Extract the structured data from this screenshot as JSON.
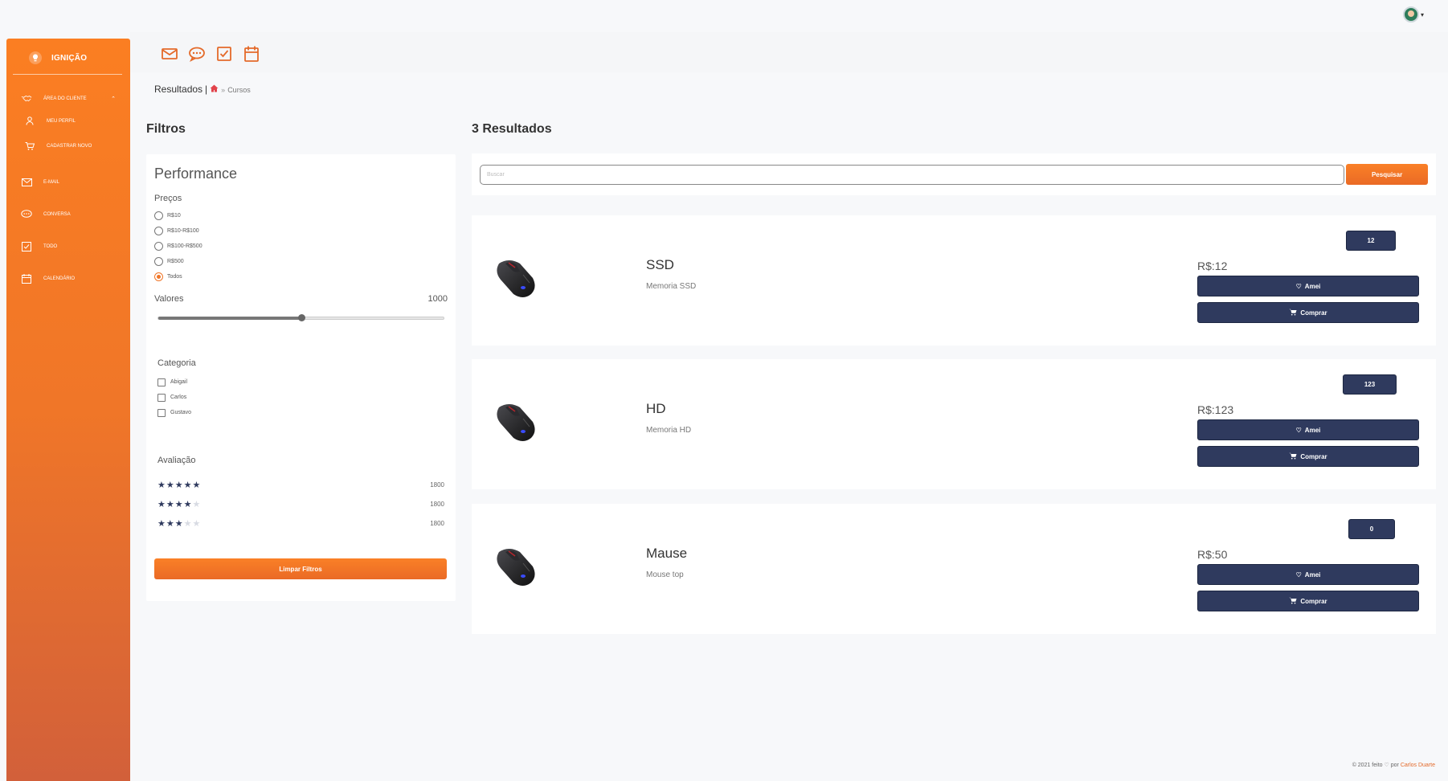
{
  "sidebar": {
    "brand": "IGNIÇÃO",
    "items": [
      {
        "label": "ÁREA DO CLIENTE",
        "icon": "handshake-icon"
      },
      {
        "label": "MEU PERFIL",
        "icon": "user-icon"
      },
      {
        "label": "CADASTRAR NOVO",
        "icon": "cart-icon"
      },
      {
        "label": "E-MAIL",
        "icon": "envelope-icon"
      },
      {
        "label": "CONVERSA",
        "icon": "chat-icon"
      },
      {
        "label": "TODO",
        "icon": "checkbox-icon"
      },
      {
        "label": "CALENDÁRIO",
        "icon": "calendar-icon"
      }
    ]
  },
  "breadcrumb": {
    "current": "Resultados",
    "separator": "|",
    "path": "Cursos"
  },
  "filters": {
    "section_title": "Filtros",
    "card_title": "Performance",
    "price_title": "Preços",
    "price_options": [
      "R$10",
      "R$10-R$100",
      "R$100-R$500",
      "R$500",
      "Todos"
    ],
    "price_selected": "Todos",
    "values_label": "Valores",
    "values_max": "1000",
    "slider_fraction": 0.5,
    "category_title": "Categoria",
    "categories": [
      "Abigail",
      "Carlos",
      "Gustavo"
    ],
    "rating_title": "Avaliação",
    "ratings": [
      {
        "stars": 5,
        "count": "1800"
      },
      {
        "stars": 4,
        "count": "1800"
      },
      {
        "stars": 3,
        "count": "1800"
      }
    ],
    "clear_label": "Limpar Filtros"
  },
  "results": {
    "title": "3 Resultados",
    "search_placeholder": "Buscar",
    "search_button": "Pesquisar",
    "products": [
      {
        "name": "SSD",
        "description": "Memoria SSD",
        "badge": "12",
        "price": "R$:12",
        "like_label": "Amei",
        "buy_label": "Comprar"
      },
      {
        "name": "HD",
        "description": "Memoria HD",
        "badge": "123",
        "price": "R$:123",
        "like_label": "Amei",
        "buy_label": "Comprar"
      },
      {
        "name": "Mause",
        "description": "Mouse top",
        "badge": "0",
        "price": "R$:50",
        "like_label": "Amei",
        "buy_label": "Comprar"
      }
    ]
  },
  "footer": {
    "prefix": "© 2021 feito",
    "middle": "por",
    "author": "Carlos Duarte"
  },
  "colors": {
    "accent": "#f07628",
    "navy": "#2f3a5e"
  }
}
